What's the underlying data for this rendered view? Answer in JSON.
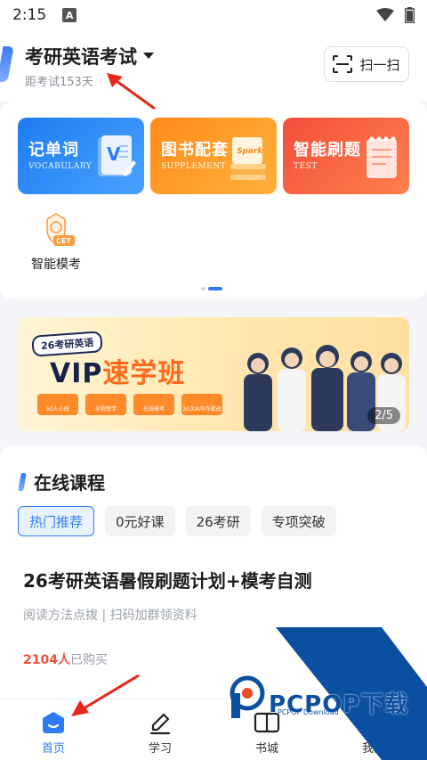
{
  "status_bar": {
    "time": "2:15",
    "notification_badge": "A",
    "icons": [
      "wifi-icon",
      "battery-icon"
    ]
  },
  "header": {
    "exam_title": "考研英语考试",
    "countdown": "距考试153天",
    "scan_label": "扫一扫"
  },
  "features": [
    {
      "title": "记单词",
      "subtitle": "VOCABULARY",
      "icon": "notebook-v-icon"
    },
    {
      "title": "图书配套",
      "subtitle": "SUPPLEMENT",
      "icon": "book-stack-icon",
      "icon_text": "Spark"
    },
    {
      "title": "智能刷题",
      "subtitle": "TEST",
      "icon": "notepad-icon"
    }
  ],
  "mock_exam": {
    "label": "智能模考",
    "badge": "CET",
    "icon": "cet-badge-icon"
  },
  "banner": {
    "tag": "26考研英语",
    "title_prefix": "VIP",
    "title_highlight": "速学班",
    "counter": "2/5",
    "chips": [
      "50人小班",
      "全程督学",
      "在线模考",
      "20次AI写作批改"
    ]
  },
  "courses": {
    "section_title": "在线课程",
    "tabs": [
      "热门推荐",
      "0元好课",
      "26考研",
      "专项突破"
    ],
    "active_tab": 0,
    "course": {
      "title": "26考研英语暑假刷题计划+模考自测",
      "description": "阅读方法点拨 | 扫码加群领资料",
      "buyers_count": "2104人",
      "buyers_suffix": "已购买"
    }
  },
  "watermark": {
    "brand": "PCPOP下载",
    "sub": "PCPOP Download"
  },
  "nav": [
    {
      "label": "首页",
      "icon": "home-icon",
      "active": true
    },
    {
      "label": "学习",
      "icon": "pen-icon",
      "active": false
    },
    {
      "label": "书城",
      "icon": "book-icon",
      "active": false
    },
    {
      "label": "我的",
      "icon": "profile-icon",
      "active": false
    }
  ],
  "colors": {
    "accent": "#2d7cf6",
    "annotation_arrow": "#e8271b"
  }
}
